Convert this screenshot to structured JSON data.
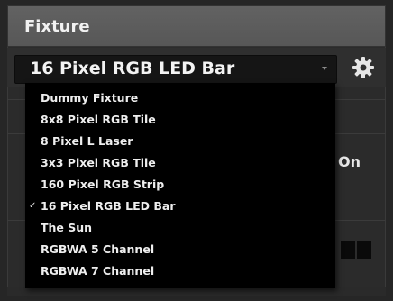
{
  "header": {
    "title": "Fixture"
  },
  "fixture_select": {
    "selected": "16 Pixel RGB LED Bar",
    "options": [
      "Dummy Fixture",
      "8x8 Pixel RGB Tile",
      "8 Pixel L Laser",
      "3x3 Pixel RGB Tile",
      "160 Pixel RGB Strip",
      "16 Pixel RGB LED Bar",
      "The Sun",
      "RGBWA 5 Channel",
      "RGBWA 7 Channel"
    ],
    "checkmark": "✓"
  },
  "background": {
    "on_label": "On"
  },
  "icons": {
    "settings": "gear-icon"
  }
}
